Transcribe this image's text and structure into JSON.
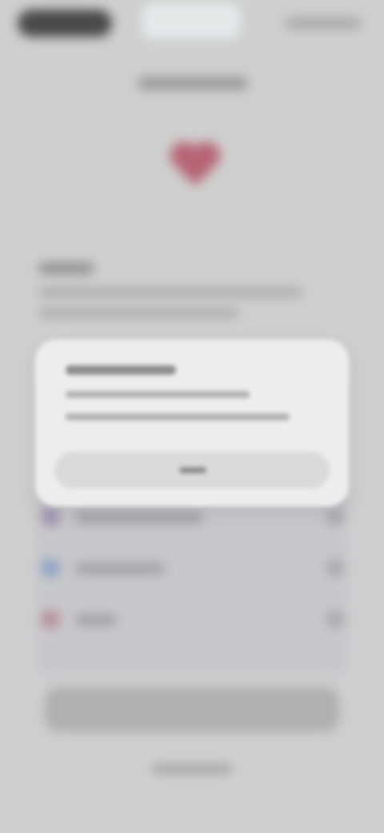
{
  "colors": {
    "background": "#d2d2d2",
    "accent_heart": "#b1445a",
    "alert_surface": "#ededed",
    "status_pill_dark": "#1f1f1f"
  },
  "icons": {
    "status_pill": "pill-shape",
    "hero": "heart-icon",
    "row_1": "row-icon",
    "row_2": "row-icon",
    "row_3": "row-icon",
    "chevron": "chevron-right-icon"
  },
  "list": {
    "rows": [
      {
        "icon_color": "#8f7fa8"
      },
      {
        "icon_color": "#7a96c6"
      },
      {
        "icon_color": "#b07d8a"
      }
    ]
  }
}
